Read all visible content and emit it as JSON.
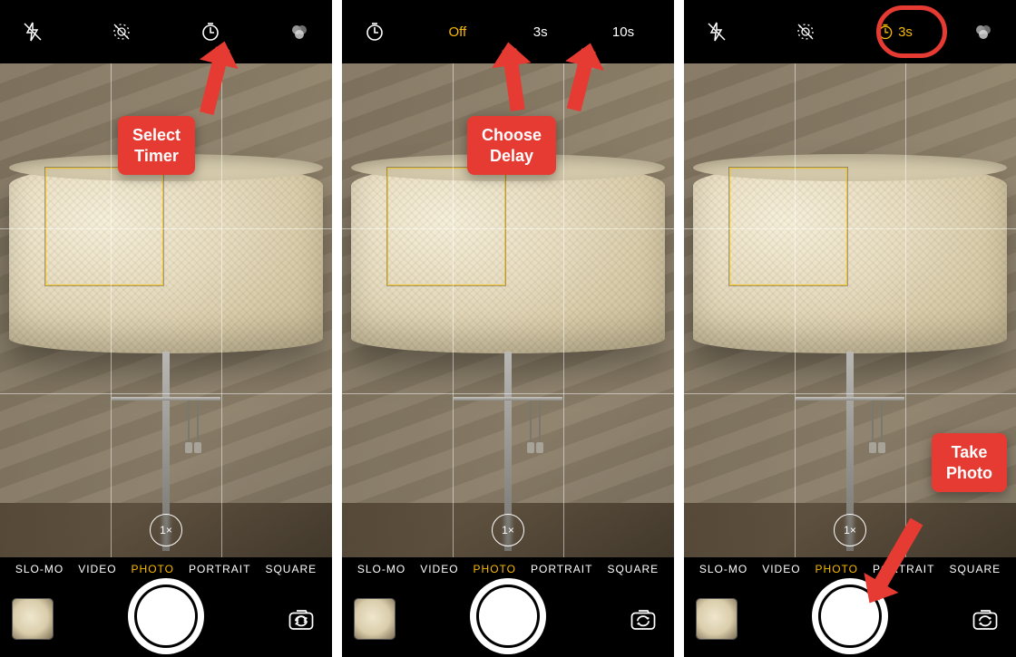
{
  "modes": {
    "slomo": "SLO-MO",
    "video": "VIDEO",
    "photo": "PHOTO",
    "portrait": "PORTRAIT",
    "square": "SQUARE"
  },
  "zoom": "1×",
  "timer_options": {
    "off": "Off",
    "s3": "3s",
    "s10": "10s"
  },
  "timer_selected": "3s",
  "callouts": {
    "select_timer": "Select\nTimer",
    "choose_delay": "Choose\nDelay",
    "take_photo": "Take\nPhoto"
  }
}
